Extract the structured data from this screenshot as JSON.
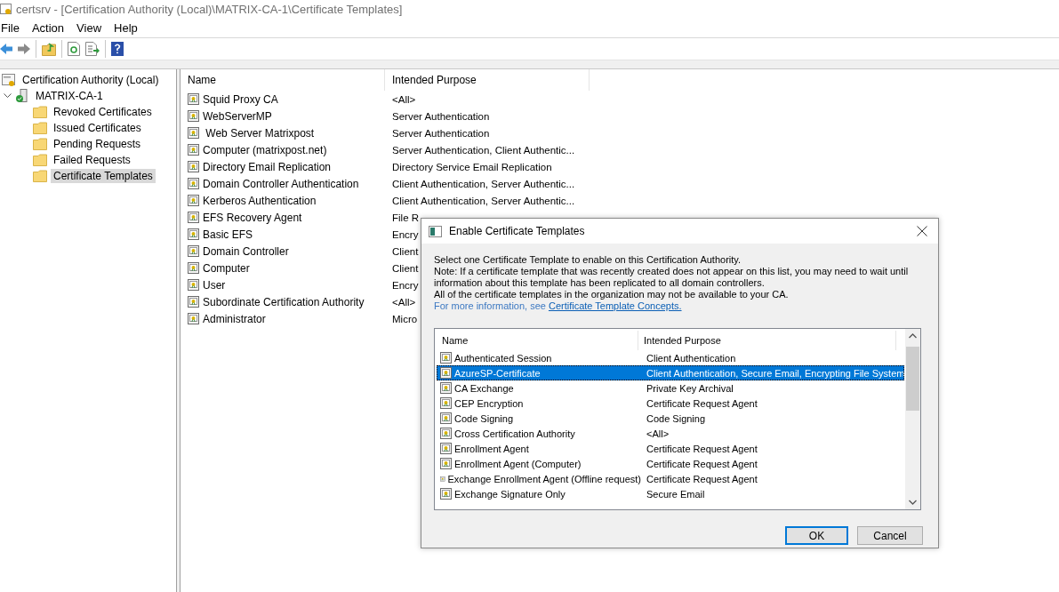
{
  "window": {
    "title": "certsrv - [Certification Authority (Local)\\MATRIX-CA-1\\Certificate Templates]"
  },
  "menu": [
    {
      "label": "File"
    },
    {
      "label": "Action"
    },
    {
      "label": "View"
    },
    {
      "label": "Help"
    }
  ],
  "tree": {
    "label": "Certification Authority (Local)",
    "children": [
      {
        "label": "MATRIX-CA-1",
        "expanded": true,
        "children": [
          {
            "label": "Revoked Certificates",
            "selected": false
          },
          {
            "label": "Issued Certificates",
            "selected": false
          },
          {
            "label": "Pending Requests",
            "selected": false
          },
          {
            "label": "Failed Requests",
            "selected": false
          },
          {
            "label": "Certificate Templates",
            "selected": true
          }
        ]
      }
    ]
  },
  "templates": {
    "columns": [
      "Name",
      "Intended Purpose"
    ],
    "rows": [
      {
        "name": "Squid Proxy CA",
        "purpose": "<All>"
      },
      {
        "name": "WebServerMP",
        "purpose": "Server Authentication"
      },
      {
        "name": " Web Server Matrixpost",
        "purpose": "Server Authentication"
      },
      {
        "name": "Computer (matrixpost.net)",
        "purpose": "Server Authentication, Client Authentic..."
      },
      {
        "name": "Directory Email Replication",
        "purpose": "Directory Service Email Replication"
      },
      {
        "name": "Domain Controller Authentication",
        "purpose": "Client Authentication, Server Authentic..."
      },
      {
        "name": "Kerberos Authentication",
        "purpose": "Client Authentication, Server Authentic..."
      },
      {
        "name": "EFS Recovery Agent",
        "purpose": "File R"
      },
      {
        "name": "Basic EFS",
        "purpose": "Encry"
      },
      {
        "name": "Domain Controller",
        "purpose": "Client"
      },
      {
        "name": "Computer",
        "purpose": "Client"
      },
      {
        "name": "User",
        "purpose": "Encry"
      },
      {
        "name": "Subordinate Certification Authority",
        "purpose": "<All>"
      },
      {
        "name": "Administrator",
        "purpose": "Micro"
      }
    ]
  },
  "dialog": {
    "title": "Enable Certificate Templates",
    "intro": "Select one Certificate Template to enable on this Certification Authority.",
    "note": "Note: If a certificate template that was recently created does not appear on this list, you may need to wait until information about this template has been replicated to all domain controllers.",
    "availability": "All of the certificate templates in the organization may not be available to your CA.",
    "more_info": "For more information, see",
    "link": "Certificate Template Concepts.",
    "columns": [
      "Name",
      "Intended Purpose"
    ],
    "rows": [
      {
        "name": "Authenticated Session",
        "purpose": "Client Authentication",
        "selected": false
      },
      {
        "name": "AzureSP-Certificate",
        "purpose": "Client Authentication, Secure Email, Encrypting File System",
        "selected": true
      },
      {
        "name": "CA Exchange",
        "purpose": "Private Key Archival",
        "selected": false
      },
      {
        "name": "CEP Encryption",
        "purpose": "Certificate Request Agent",
        "selected": false
      },
      {
        "name": "Code Signing",
        "purpose": "Code Signing",
        "selected": false
      },
      {
        "name": "Cross Certification Authority",
        "purpose": "<All>",
        "selected": false
      },
      {
        "name": "Enrollment Agent",
        "purpose": "Certificate Request Agent",
        "selected": false
      },
      {
        "name": "Enrollment Agent (Computer)",
        "purpose": "Certificate Request Agent",
        "selected": false
      },
      {
        "name": "Exchange Enrollment Agent (Offline request)",
        "purpose": "Certificate Request Agent",
        "selected": false
      },
      {
        "name": "Exchange Signature Only",
        "purpose": "Secure Email",
        "selected": false
      }
    ],
    "buttons": [
      {
        "label": "OK",
        "default": true
      },
      {
        "label": "Cancel",
        "default": false
      }
    ]
  }
}
